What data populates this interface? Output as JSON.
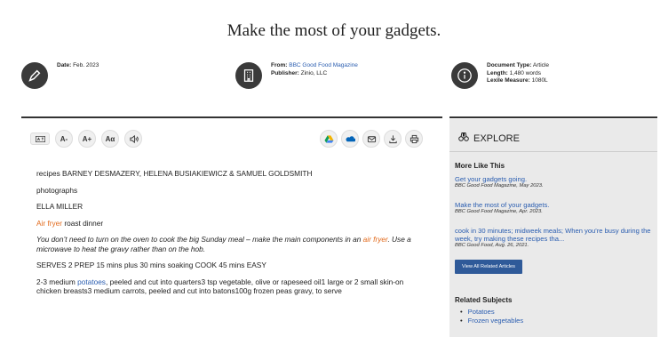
{
  "header": {
    "title": "Make the most of your gadgets."
  },
  "meta": {
    "date_label": "Date:",
    "date_value": "Feb. 2023",
    "from_label": "From:",
    "from_value": "BBC Good Food Magazine",
    "publisher_label": "Publisher:",
    "publisher_value": "Zinio, LLC",
    "doctype_label": "Document Type:",
    "doctype_value": "Article",
    "length_label": "Length:",
    "length_value": "1,480 words",
    "lexile_label": "Lexile Measure:",
    "lexile_value": "1080L"
  },
  "toolbar": {
    "font_smaller": "A-",
    "font_larger": "A+",
    "font_style": "Aα"
  },
  "article": {
    "byline": "recipes BARNEY DESMAZERY, HELENA BUSIAKIEWICZ & SAMUEL GOLDSMITH",
    "photo_label": "photographs",
    "photographer": "ELLA MILLER",
    "heading_link": "Air fryer",
    "heading_rest": " roast dinner",
    "intro_a": "You don’t need to turn on the oven to cook the big Sunday meal – make the main components in an ",
    "intro_link": "air fryer",
    "intro_b": ". Use a microwave to heat the gravy rather than on the hob.",
    "serves": "SERVES 2 PREP 15 mins plus 30 mins soaking COOK 45 mins EASY",
    "ingredients_a": "2-3 medium ",
    "ingredients_link": "potatoes",
    "ingredients_b": ", peeled and cut into quarters3 tsp vegetable, olive or rapeseed oil1 large or 2 small skin-on chicken breasts3 medium carrots, peeled and cut into batons100g frozen peas gravy, to serve"
  },
  "sidebar": {
    "explore_label": "EXPLORE",
    "more_like_this": "More Like This",
    "items": [
      {
        "title": "Get your gadgets going.",
        "source": "BBC Good Food Magazine, May 2023."
      },
      {
        "title": "Make the most of your gadgets.",
        "source": "BBC Good Food Magazine, Apr. 2023."
      },
      {
        "title": "cook in 30 minutes; midweek meals; When you're busy during the week, try making these recipes tha...",
        "source": "BBC Good Food, Aug. 26, 2021."
      }
    ],
    "view_all": "View All Related Articles",
    "related_subjects": "Related Subjects",
    "subjects": [
      "Potatoes",
      "Frozen vegetables"
    ]
  },
  "colors": {
    "link": "#2a5db0",
    "highlight": "#e26a1c",
    "button": "#2f5a99",
    "sidebar_bg": "#eaeaea"
  }
}
